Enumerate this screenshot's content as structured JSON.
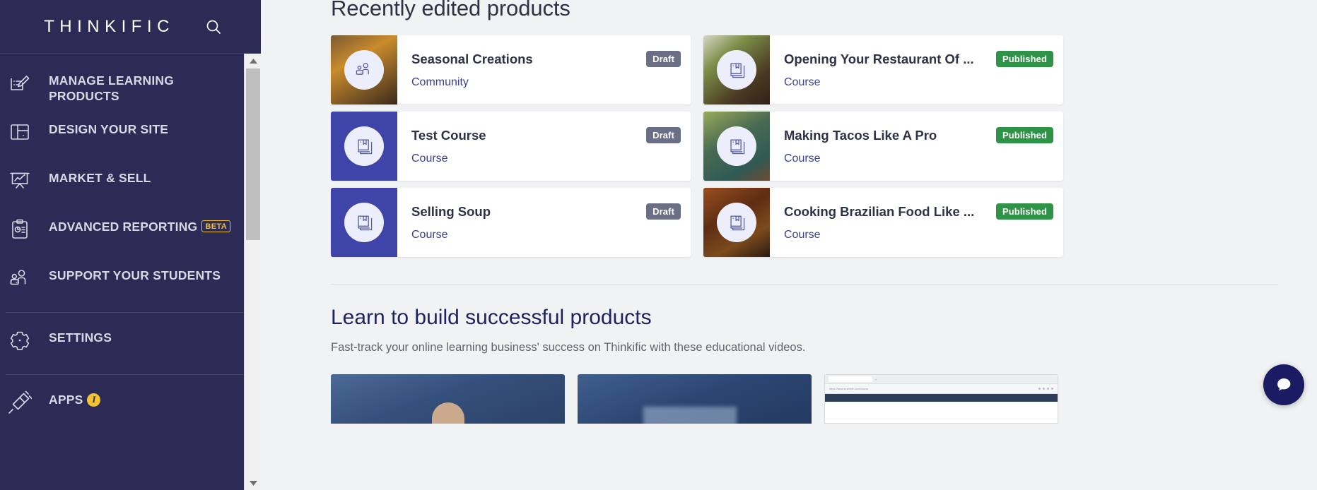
{
  "sidebar": {
    "brand": "THINKIFIC",
    "search_icon": "search-icon",
    "items": [
      {
        "label": "MANAGE LEARNING PRODUCTS",
        "icon": "edit-list-icon",
        "badge": null
      },
      {
        "label": "DESIGN YOUR SITE",
        "icon": "layout-icon",
        "badge": null
      },
      {
        "label": "MARKET & SELL",
        "icon": "presentation-chart-icon",
        "badge": null
      },
      {
        "label": "ADVANCED REPORTING",
        "icon": "clipboard-report-icon",
        "badge": "BETA"
      },
      {
        "label": "SUPPORT YOUR STUDENTS",
        "icon": "people-icon",
        "badge": null
      },
      {
        "label": "SETTINGS",
        "icon": "gear-icon",
        "badge": null
      },
      {
        "label": "APPS",
        "icon": "plug-icon",
        "badge": "i"
      }
    ]
  },
  "main": {
    "recent_title": "Recently edited products",
    "products": [
      {
        "title": "Seasonal Creations",
        "type": "Community",
        "status": "Draft",
        "thumb": "photo-cupcakes",
        "icon": "community-icon"
      },
      {
        "title": "Opening Your Restaurant Of ...",
        "type": "Course",
        "status": "Published",
        "thumb": "photo-herb-dish",
        "icon": "book-icon"
      },
      {
        "title": "Test Course",
        "type": "Course",
        "status": "Draft",
        "thumb": "solid-indigo",
        "icon": "book-icon"
      },
      {
        "title": "Making Tacos Like A Pro",
        "type": "Course",
        "status": "Published",
        "thumb": "photo-tacos",
        "icon": "book-icon"
      },
      {
        "title": "Selling Soup",
        "type": "Course",
        "status": "Draft",
        "thumb": "solid-indigo",
        "icon": "book-icon"
      },
      {
        "title": "Cooking Brazilian Food Like ...",
        "type": "Course",
        "status": "Published",
        "thumb": "photo-brazilian",
        "icon": "book-icon"
      }
    ],
    "learn_title": "Learn to build successful products",
    "learn_subtitle": "Fast-track your online learning business' success on Thinkific with these educational videos.",
    "videos": [
      {
        "name": "video-thumb-presenter"
      },
      {
        "name": "video-thumb-screen"
      },
      {
        "name": "video-thumb-browser"
      }
    ]
  },
  "chat": {
    "icon": "chat-bubble-icon"
  },
  "colors": {
    "sidebar_bg": "#2b2b55",
    "accent_indigo": "#3b3f8f",
    "draft_badge": "#6b6f85",
    "published_badge": "#2e9346",
    "beta_yellow": "#f2c230"
  }
}
